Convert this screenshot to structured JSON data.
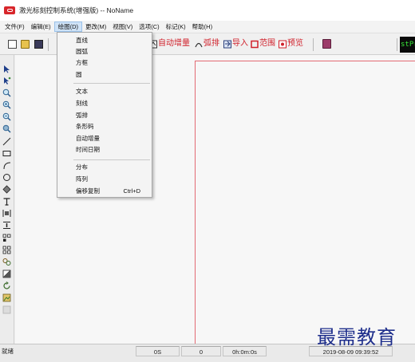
{
  "window": {
    "title": "激光标刻控制系统(增强版) -- NoName"
  },
  "menubar": {
    "items": [
      {
        "label": "文件(F)"
      },
      {
        "label": "编辑(E)"
      },
      {
        "label": "绘图(D)"
      },
      {
        "label": "更改(M)"
      },
      {
        "label": "视图(V)"
      },
      {
        "label": "选项(C)"
      },
      {
        "label": "标记(K)"
      },
      {
        "label": "帮助(H)"
      }
    ],
    "active": "绘图(D)"
  },
  "toolbar": {
    "auto_increment": "自动增量",
    "arc_layout": "弧排",
    "import": "导入",
    "range": "范围",
    "preview": "预览",
    "digital_display": "stPr"
  },
  "draw_menu": {
    "groups": [
      [
        {
          "label": "直线"
        },
        {
          "label": "圆弧"
        },
        {
          "label": "方框"
        },
        {
          "label": "圆"
        }
      ],
      [
        {
          "label": "文本"
        },
        {
          "label": "刻线"
        },
        {
          "label": "弧排"
        },
        {
          "label": "条形码"
        },
        {
          "label": "自动增量"
        },
        {
          "label": "时间日期"
        }
      ],
      [
        {
          "label": "分布"
        },
        {
          "label": "阵列"
        },
        {
          "label": "偏移复制",
          "shortcut": "Ctrl+D"
        }
      ]
    ]
  },
  "statusbar": {
    "ready": "就绪",
    "count": "0S",
    "value": "0",
    "elapsed": "0h:0m:0s",
    "datetime": "2019-08-09 09:39:52"
  },
  "watermark": "最需教育",
  "colors": {
    "accent_red": "#d0202a",
    "frame_line": "#e26a73",
    "menu_highlight": "#cfe3f7",
    "watermark": "#1f2f8c"
  }
}
